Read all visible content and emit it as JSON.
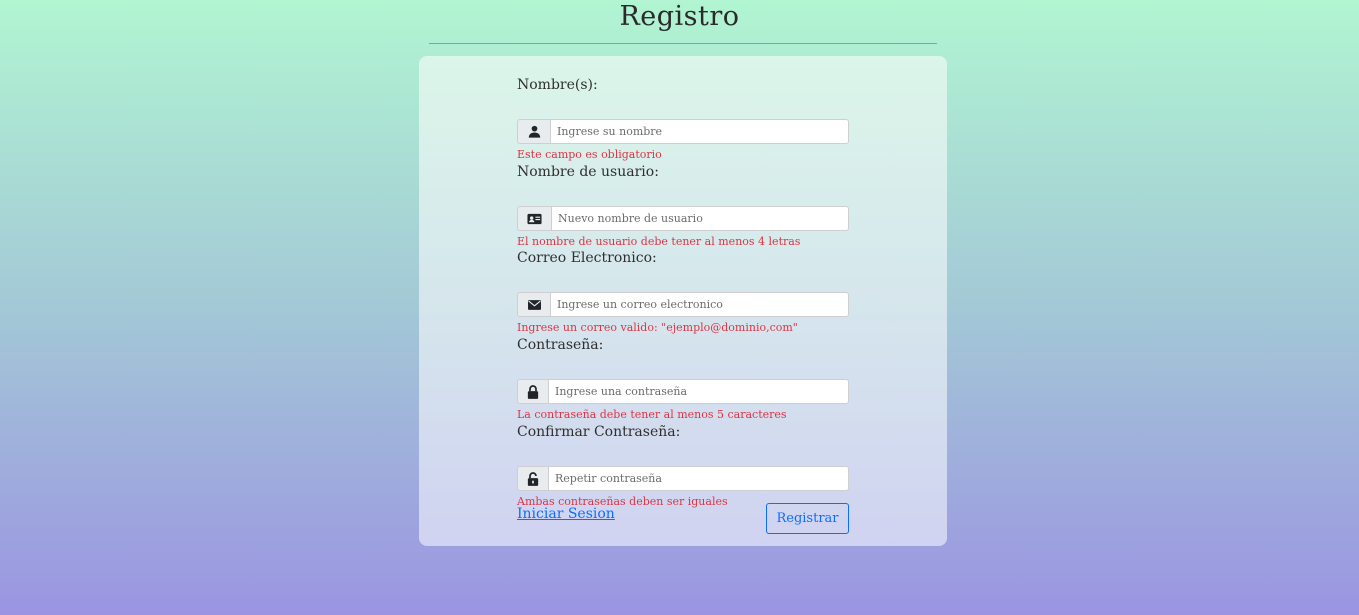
{
  "page": {
    "title": "Registro"
  },
  "form": {
    "fields": [
      {
        "label": "Nombre(s):",
        "placeholder": "Ingrese su nombre",
        "value": "",
        "icon": "user-icon",
        "error": "Este campo es obligatorio"
      },
      {
        "label": "Nombre de usuario:",
        "placeholder": "Nuevo nombre de usuario",
        "value": "",
        "icon": "id-card-icon",
        "error": "El nombre de usuario debe tener al menos 4 letras"
      },
      {
        "label": "Correo Electronico:",
        "placeholder": "Ingrese un correo electronico",
        "value": "",
        "icon": "envelope-icon",
        "error": "Ingrese un correo valido: \"ejemplo@dominio,com\""
      },
      {
        "label": "Contraseña:",
        "placeholder": "Ingrese una contraseña",
        "value": "",
        "icon": "lock-icon",
        "error": "La contraseña debe tener al menos 5 caracteres"
      },
      {
        "label": "Confirmar Contraseña:",
        "placeholder": "Repetir contraseña",
        "value": "",
        "icon": "unlock-icon",
        "error": "Ambas contraseñas deben ser iguales"
      }
    ],
    "login_link": "Iniciar Sesion",
    "submit_label": "Registrar"
  },
  "colors": {
    "error": "#dc3545",
    "primary": "#0d6efd",
    "gradient_top": "#b1f5d2",
    "gradient_bottom": "#9b94e2"
  }
}
